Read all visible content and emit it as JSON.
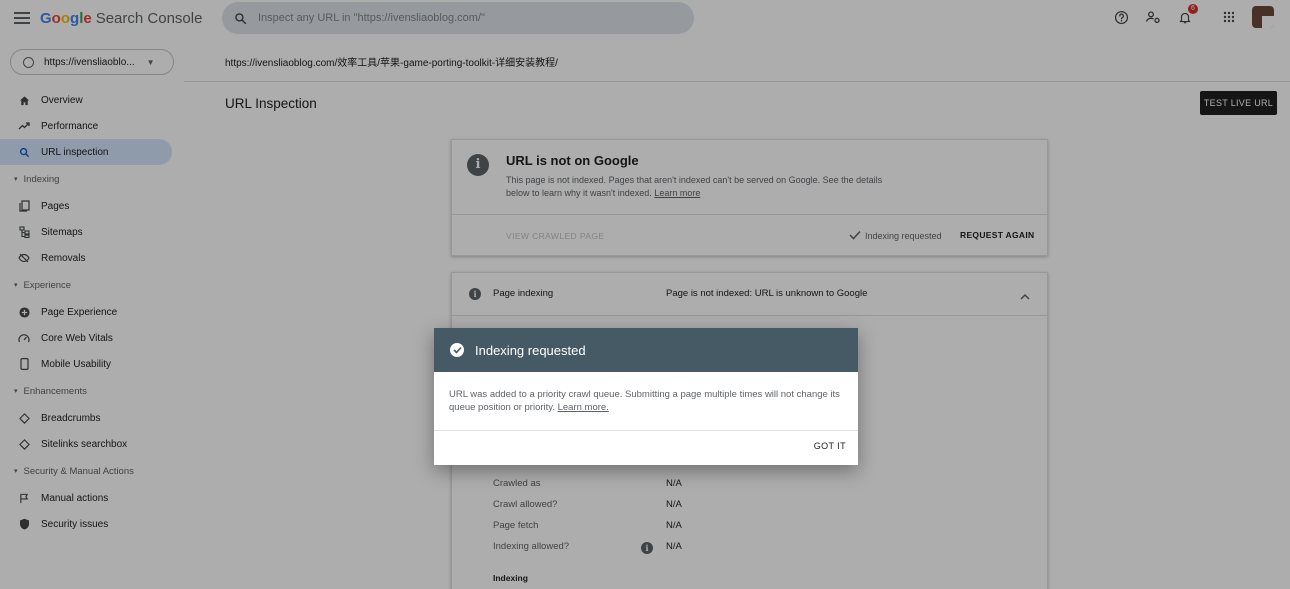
{
  "header": {
    "brand_letters": [
      {
        "ch": "G",
        "color": "#4285F4"
      },
      {
        "ch": "o",
        "color": "#EA4335"
      },
      {
        "ch": "o",
        "color": "#FBBC05"
      },
      {
        "ch": "g",
        "color": "#4285F4"
      },
      {
        "ch": "l",
        "color": "#34A853"
      },
      {
        "ch": "e",
        "color": "#EA4335"
      }
    ],
    "product": "Search Console",
    "search_placeholder": "Inspect any URL in \"https://ivensliaoblog.com/\"",
    "notification_count": "6"
  },
  "sidebar": {
    "property": "https://ivensliaoblo...",
    "items": [
      {
        "type": "item",
        "label": "Overview",
        "icon": "home-icon",
        "active": false
      },
      {
        "type": "item",
        "label": "Performance",
        "icon": "trending-up-icon",
        "active": false
      },
      {
        "type": "item",
        "label": "URL inspection",
        "icon": "search-icon",
        "active": true
      },
      {
        "type": "section",
        "label": "Indexing"
      },
      {
        "type": "item",
        "label": "Pages",
        "icon": "pages-icon",
        "active": false
      },
      {
        "type": "item",
        "label": "Sitemaps",
        "icon": "sitemap-icon",
        "active": false
      },
      {
        "type": "item",
        "label": "Removals",
        "icon": "eye-off-icon",
        "active": false
      },
      {
        "type": "section",
        "label": "Experience"
      },
      {
        "type": "item",
        "label": "Page Experience",
        "icon": "plus-circle-icon",
        "active": false
      },
      {
        "type": "item",
        "label": "Core Web Vitals",
        "icon": "gauge-icon",
        "active": false
      },
      {
        "type": "item",
        "label": "Mobile Usability",
        "icon": "phone-icon",
        "active": false
      },
      {
        "type": "section",
        "label": "Enhancements"
      },
      {
        "type": "item",
        "label": "Breadcrumbs",
        "icon": "diamond-icon",
        "active": false
      },
      {
        "type": "item",
        "label": "Sitelinks searchbox",
        "icon": "diamond-icon",
        "active": false
      },
      {
        "type": "section",
        "label": "Security & Manual Actions"
      },
      {
        "type": "item",
        "label": "Manual actions",
        "icon": "flag-icon",
        "active": false
      },
      {
        "type": "item",
        "label": "Security issues",
        "icon": "shield-icon",
        "active": false
      }
    ]
  },
  "main": {
    "inspected_url": "https://ivensliaoblog.com/效率工具/苹果-game-porting-toolkit-详细安装教程/",
    "page_title": "URL Inspection",
    "test_live_label": "TEST LIVE URL",
    "status_card": {
      "title": "URL is not on Google",
      "body": "This page is not indexed. Pages that aren't indexed can't be served on Google. See the details below to learn why it wasn't indexed.",
      "learn_more": "Learn more",
      "view_crawled": "VIEW CRAWLED PAGE",
      "indexing_requested": "Indexing requested",
      "request_again": "REQUEST AGAIN"
    },
    "page_indexing": {
      "label": "Page indexing",
      "status": "Page is not indexed: URL is unknown to Google",
      "rows": [
        {
          "label": "Crawled as",
          "value": "N/A",
          "info": false
        },
        {
          "label": "Crawl allowed?",
          "value": "N/A",
          "info": false
        },
        {
          "label": "Page fetch",
          "value": "N/A",
          "info": false
        },
        {
          "label": "Indexing allowed?",
          "value": "N/A",
          "info": true
        }
      ],
      "section_heading": "Indexing"
    }
  },
  "dialog": {
    "title": "Indexing requested",
    "body": "URL was added to a priority crawl queue. Submitting a page multiple times will not change its queue position or priority.",
    "learn_more": "Learn more.",
    "button": "GOT IT"
  },
  "colors": {
    "active_nav": "#d3e3fd",
    "dialog_header": "#455a64",
    "search_bg": "#dde3ea"
  }
}
